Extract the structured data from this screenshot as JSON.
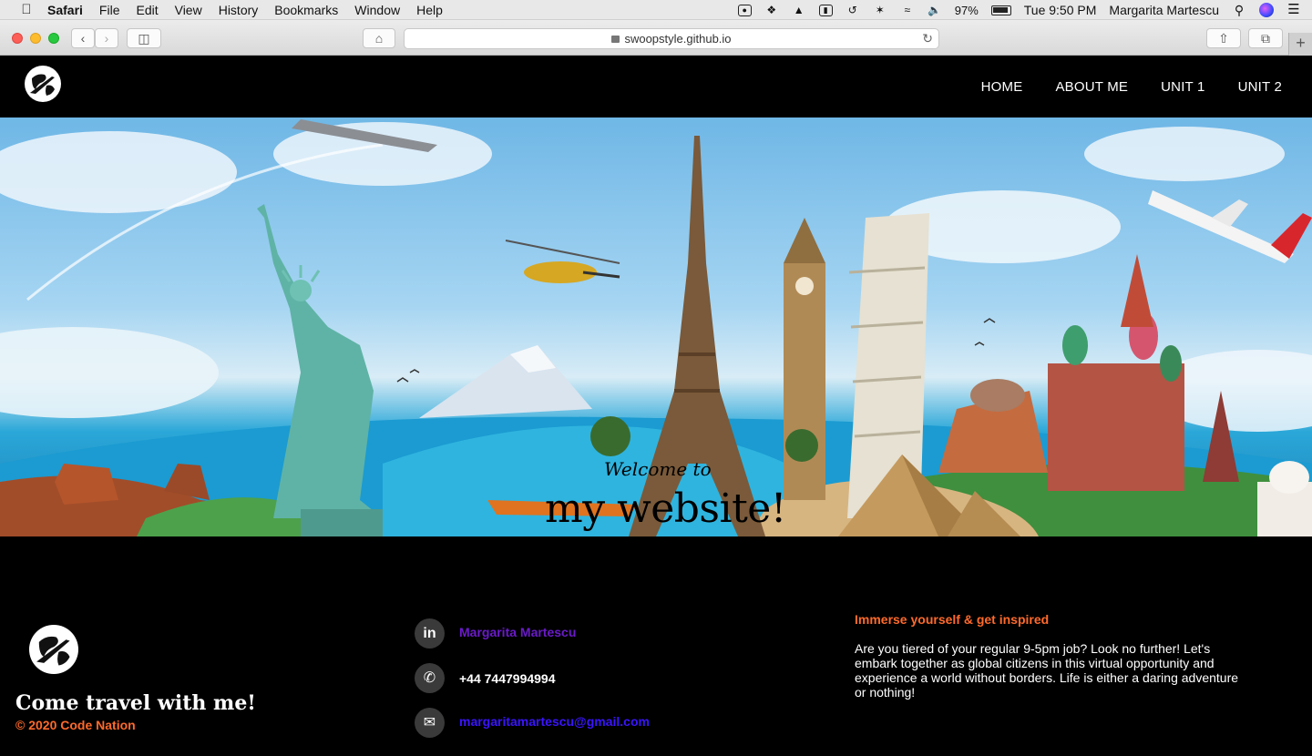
{
  "macos_menubar": {
    "apple_icon": "apple-logo",
    "app_name": "Safari",
    "menus": [
      "File",
      "Edit",
      "View",
      "History",
      "Bookmarks",
      "Window",
      "Help"
    ],
    "battery_percent": "97%",
    "clock": "Tue 9:50 PM",
    "user_name": "Margarita Martescu"
  },
  "browser": {
    "url": "swoopstyle.github.io",
    "back_icon": "chevron-left",
    "forward_icon": "chevron-right",
    "sidebar_icon": "sidebar",
    "home_icon": "house",
    "reload_icon": "reload",
    "share_icon": "share",
    "tabs_icon": "tabs",
    "new_tab_label": "+"
  },
  "site": {
    "nav": {
      "logo_icon": "globe-plane-logo",
      "links": [
        "HOME",
        "ABOUT ME",
        "UNIT 1",
        "UNIT 2"
      ]
    },
    "hero": {
      "welcome": "Welcome to",
      "title": "my website!"
    },
    "footer": {
      "tagline": "Come travel with me!",
      "copyright": "© 2020 Code Nation",
      "contacts": {
        "linkedin": {
          "icon": "linkedin-icon",
          "label": "Margarita Martescu",
          "color": "#6a1bc9"
        },
        "phone": {
          "icon": "phone-icon",
          "label": "+44 7447994994",
          "color": "#ffffff"
        },
        "email": {
          "icon": "envelope-icon",
          "label": "margaritamartescu@gmail.com",
          "color": "#3b14ff"
        }
      },
      "about_heading": "Immerse yourself & get inspired",
      "about_text": "Are you tiered of your regular 9-5pm job? Look no further! Let's embark together as global citizens in this virtual opportunity and experience a world without borders. Life is either a daring adventure or nothing!"
    }
  },
  "colors": {
    "accent_orange": "#ff6a2b",
    "nav_bg": "#000000"
  }
}
